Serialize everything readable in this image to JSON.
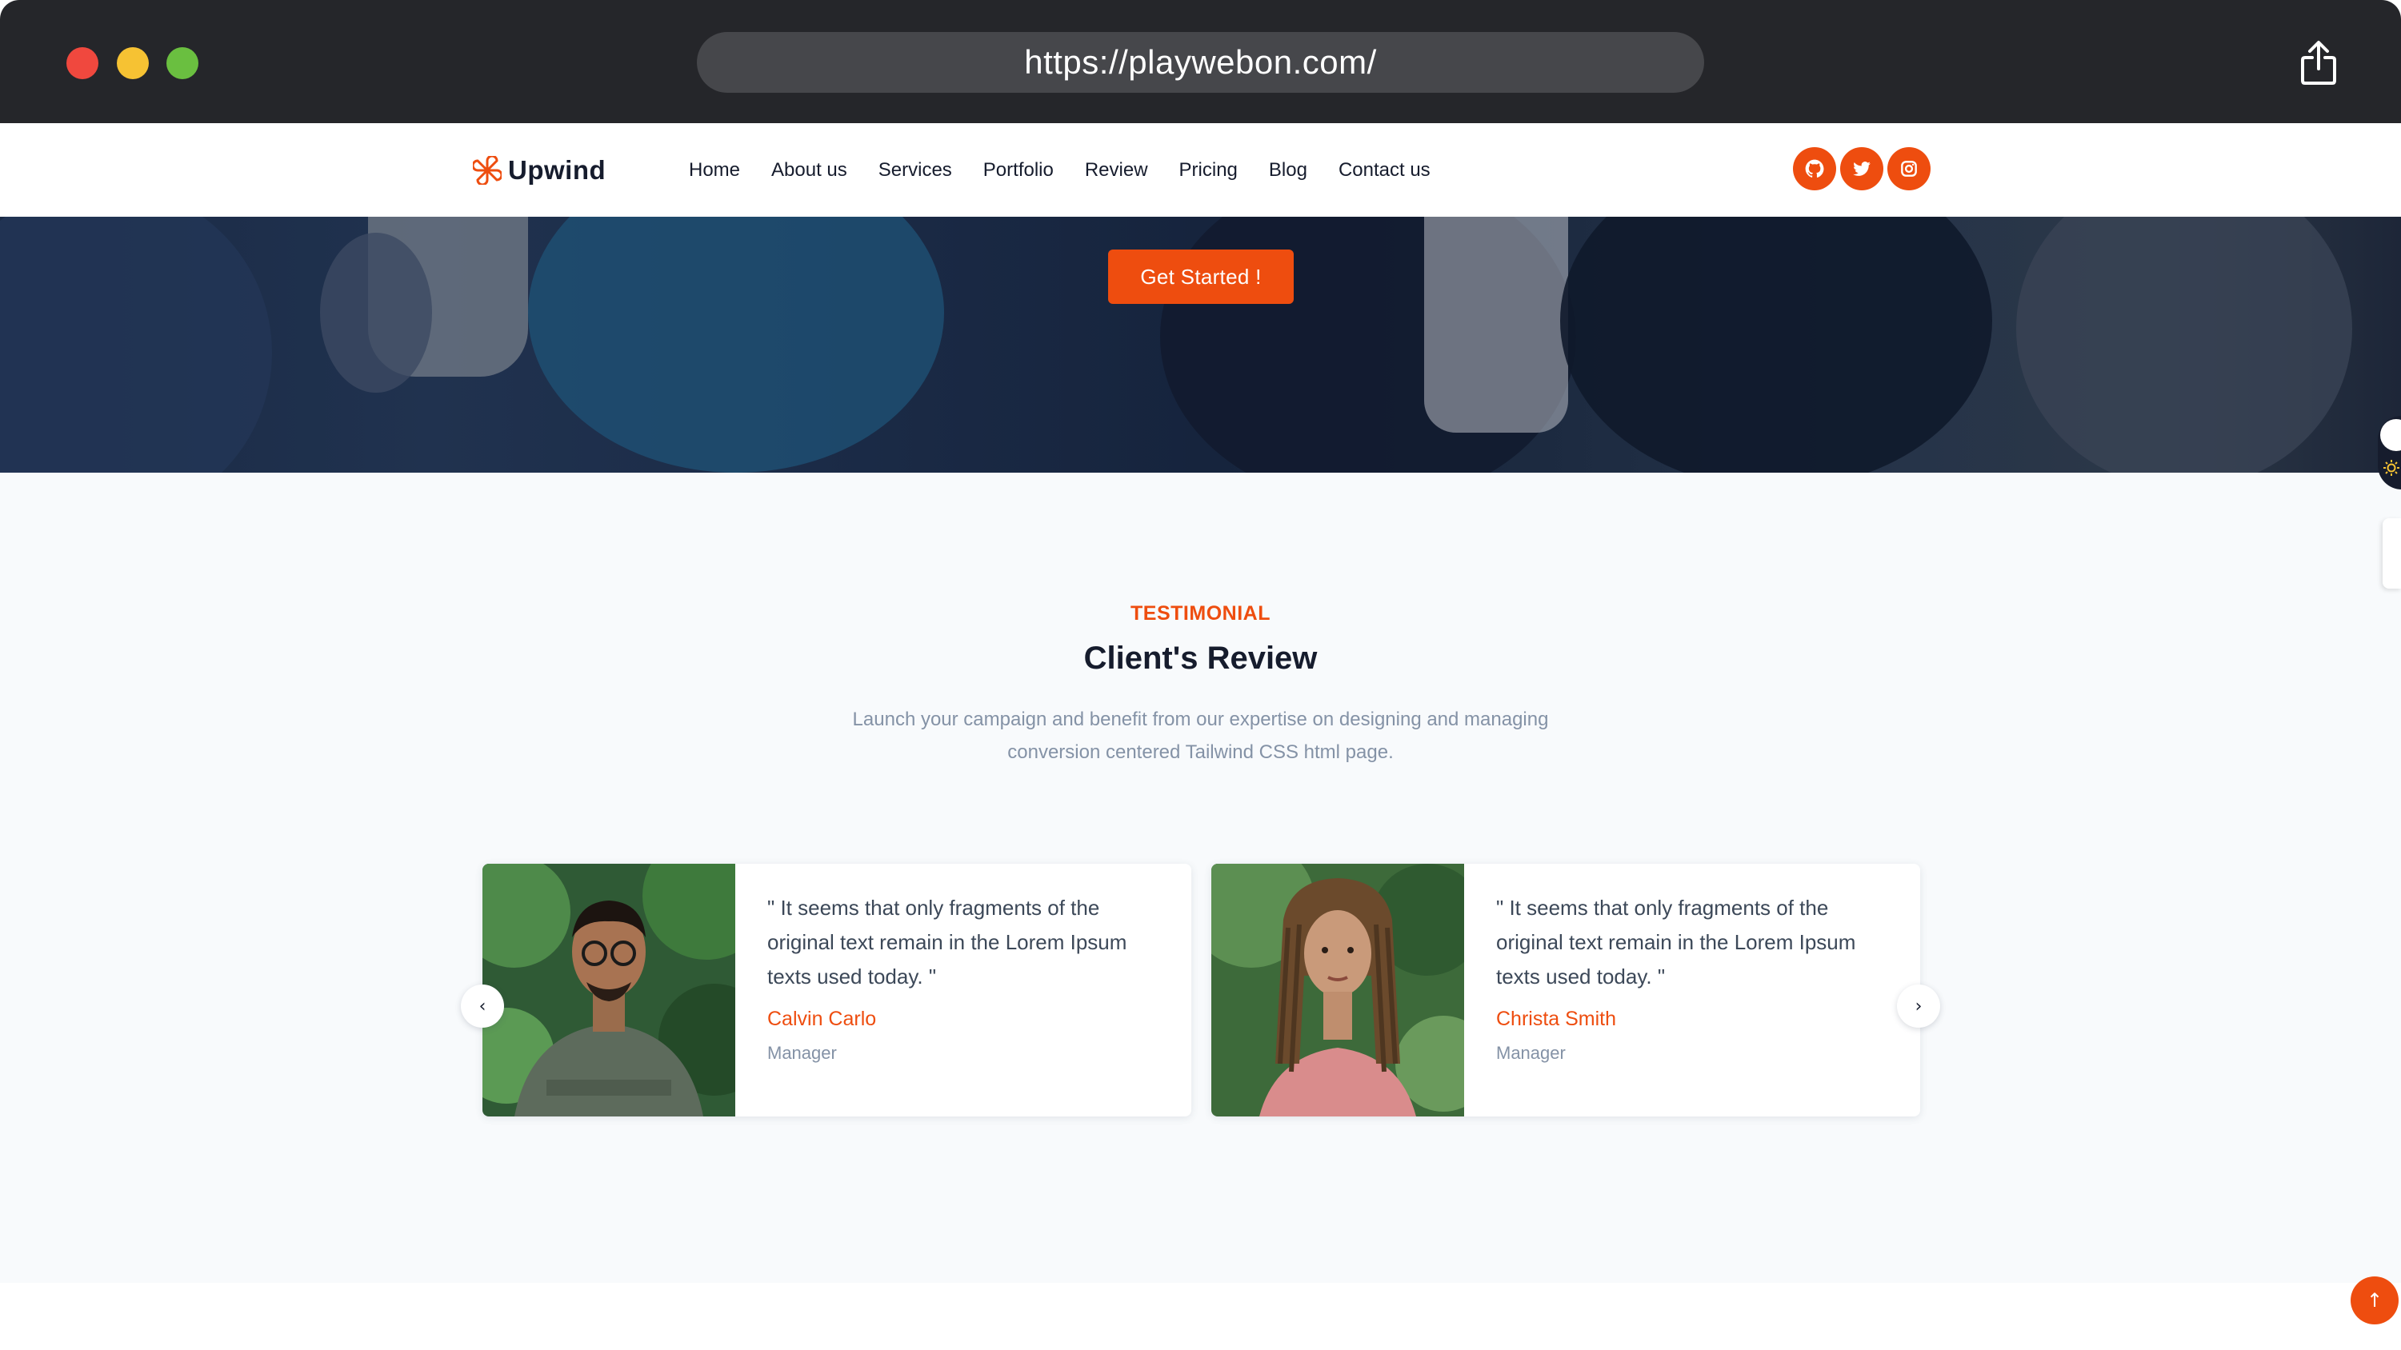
{
  "browser": {
    "url": "https://playwebon.com/"
  },
  "navbar": {
    "brand": "Upwind",
    "items": [
      {
        "label": "Home"
      },
      {
        "label": "About us"
      },
      {
        "label": "Services"
      },
      {
        "label": "Portfolio"
      },
      {
        "label": "Review"
      },
      {
        "label": "Pricing"
      },
      {
        "label": "Blog"
      },
      {
        "label": "Contact us"
      }
    ],
    "social_icons": [
      "github-icon",
      "twitter-icon",
      "instagram-icon"
    ]
  },
  "hero": {
    "cta_label": "Get Started !"
  },
  "testimonials": {
    "eyebrow": "TESTIMONIAL",
    "heading": "Client's Review",
    "description_line1": "Launch your campaign and benefit from our expertise on designing and managing",
    "description_line2": "conversion centered Tailwind CSS html page.",
    "cards": [
      {
        "quote": "\" It seems that only fragments of the original text remain in the Lorem Ipsum texts used today. \"",
        "name": "Calvin Carlo",
        "role": "Manager"
      },
      {
        "quote": "\" It seems that only fragments of the original text remain in the Lorem Ipsum texts used today. \"",
        "name": "Christa Smith",
        "role": "Manager"
      }
    ],
    "prev_icon": "chevron-left-icon",
    "next_icon": "chevron-right-icon"
  },
  "colors": {
    "accent": "#ee4d0f",
    "heading": "#161c2d",
    "muted": "#8492a6",
    "section_bg": "#f8fafc",
    "chrome_bg": "#25262a"
  }
}
